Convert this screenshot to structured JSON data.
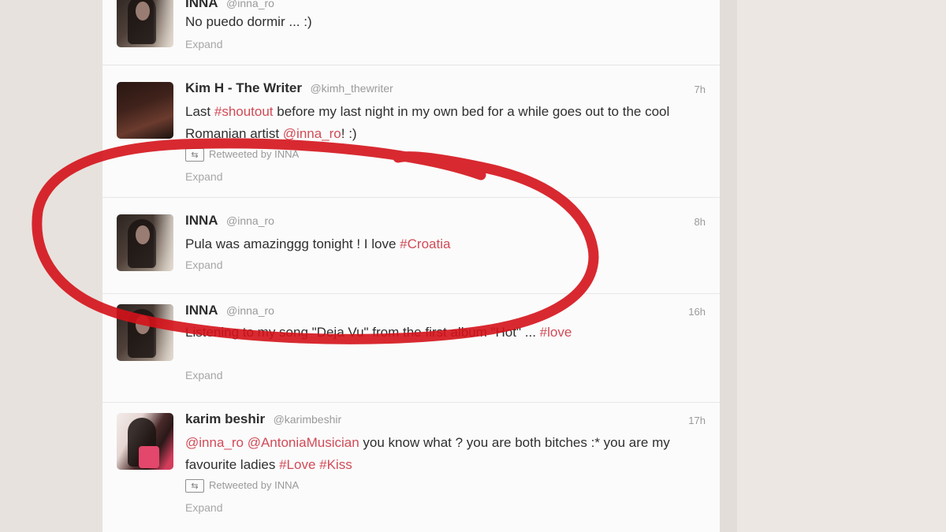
{
  "tweets": [
    {
      "name": "INNA",
      "handle": "@inna_ro",
      "time": "",
      "segments": [
        {
          "text": "No puedo dormir ... :)",
          "type": "plain"
        }
      ],
      "retweet": null,
      "expand": "Expand"
    },
    {
      "name": "Kim H - The Writer",
      "handle": "@kimh_thewriter",
      "time": "7h",
      "segments": [
        {
          "text": "Last ",
          "type": "plain"
        },
        {
          "text": "#shoutout",
          "type": "tag"
        },
        {
          "text": " before my last night in my own bed for a while goes out to the cool Romanian artist ",
          "type": "plain"
        },
        {
          "text": "@inna_ro",
          "type": "tag"
        },
        {
          "text": "! :)",
          "type": "plain"
        }
      ],
      "retweet": "Retweeted by INNA",
      "expand": "Expand"
    },
    {
      "name": "INNA",
      "handle": "@inna_ro",
      "time": "8h",
      "segments": [
        {
          "text": "Pula was amazinggg tonight ! I love ",
          "type": "plain"
        },
        {
          "text": "#Croatia",
          "type": "tag"
        }
      ],
      "retweet": null,
      "expand": "Expand"
    },
    {
      "name": "INNA",
      "handle": "@inna_ro",
      "time": "16h",
      "segments": [
        {
          "text": "Listening to my song \"Deja Vu\" from the first album \"Hot\" ... ",
          "type": "plain"
        },
        {
          "text": "#love",
          "type": "tag"
        }
      ],
      "retweet": null,
      "expand": "Expand"
    },
    {
      "name": "karim beshir",
      "handle": "@karimbeshir",
      "time": "17h",
      "segments": [
        {
          "text": "@inna_ro",
          "type": "tag"
        },
        {
          "text": " ",
          "type": "plain"
        },
        {
          "text": "@AntoniaMusician",
          "type": "tag"
        },
        {
          "text": " you know what ? you are both bitches :* you are my favourite ladies ",
          "type": "plain"
        },
        {
          "text": "#Love",
          "type": "tag"
        },
        {
          "text": " ",
          "type": "plain"
        },
        {
          "text": "#Kiss",
          "type": "tag"
        }
      ],
      "retweet": "Retweeted by INNA",
      "expand": "Expand"
    }
  ],
  "icons": {
    "retweet": "retweet-icon",
    "annotation": "red-hand-drawn-circle"
  },
  "colors": {
    "hashtag": "#d14b57",
    "annotation": "#d4121a"
  }
}
